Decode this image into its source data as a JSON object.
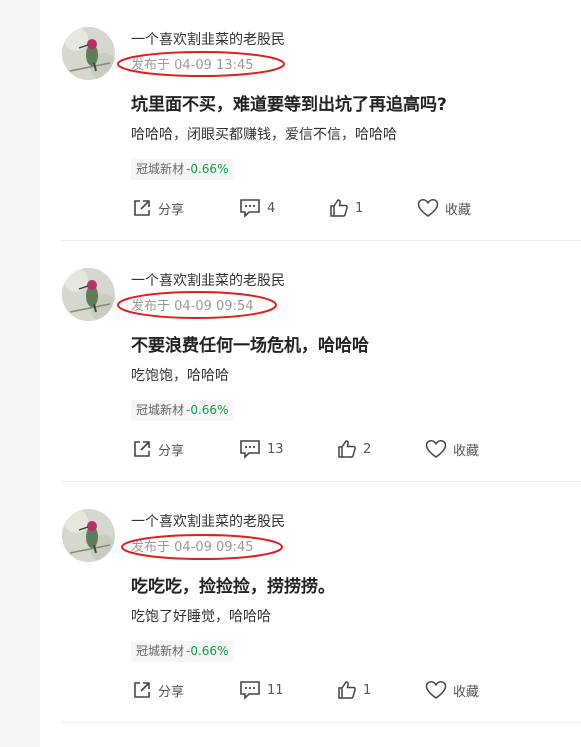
{
  "feed": {
    "posts": [
      {
        "author": "一个喜欢割韭菜的老股民",
        "time": "发布于 04-09 13:45",
        "title": "坑里面不买，难道要等到出坑了再追高吗?",
        "body": "哈哈哈，闭眼买都赚钱，爱信不信，哈哈哈",
        "stock_name": "冠城新材",
        "stock_change": "-0.66%",
        "share_label": "分享",
        "comment_count": "4",
        "like_count": "1",
        "collect_label": "收藏"
      },
      {
        "author": "一个喜欢割韭菜的老股民",
        "time": "发布于 04-09 09:54",
        "title": "不要浪费任何一场危机，哈哈哈",
        "body": "吃饱饱，哈哈哈",
        "stock_name": "冠城新材",
        "stock_change": "-0.66%",
        "share_label": "分享",
        "comment_count": "13",
        "like_count": "2",
        "collect_label": "收藏"
      },
      {
        "author": "一个喜欢割韭菜的老股民",
        "time": "发布于 04-09 09:45",
        "title": "吃吃吃，捡捡捡，捞捞捞。",
        "body": "吃饱了好睡觉，哈哈哈",
        "stock_name": "冠城新材",
        "stock_change": "-0.66%",
        "share_label": "分享",
        "comment_count": "11",
        "like_count": "1",
        "collect_label": "收藏"
      }
    ]
  },
  "colors": {
    "annotation_circle": "#e0201c",
    "stock_down": "#0e9e49"
  },
  "icons": {
    "share": "share-icon",
    "comment": "comment-icon",
    "like": "thumbs-up-icon",
    "collect": "heart-icon"
  }
}
